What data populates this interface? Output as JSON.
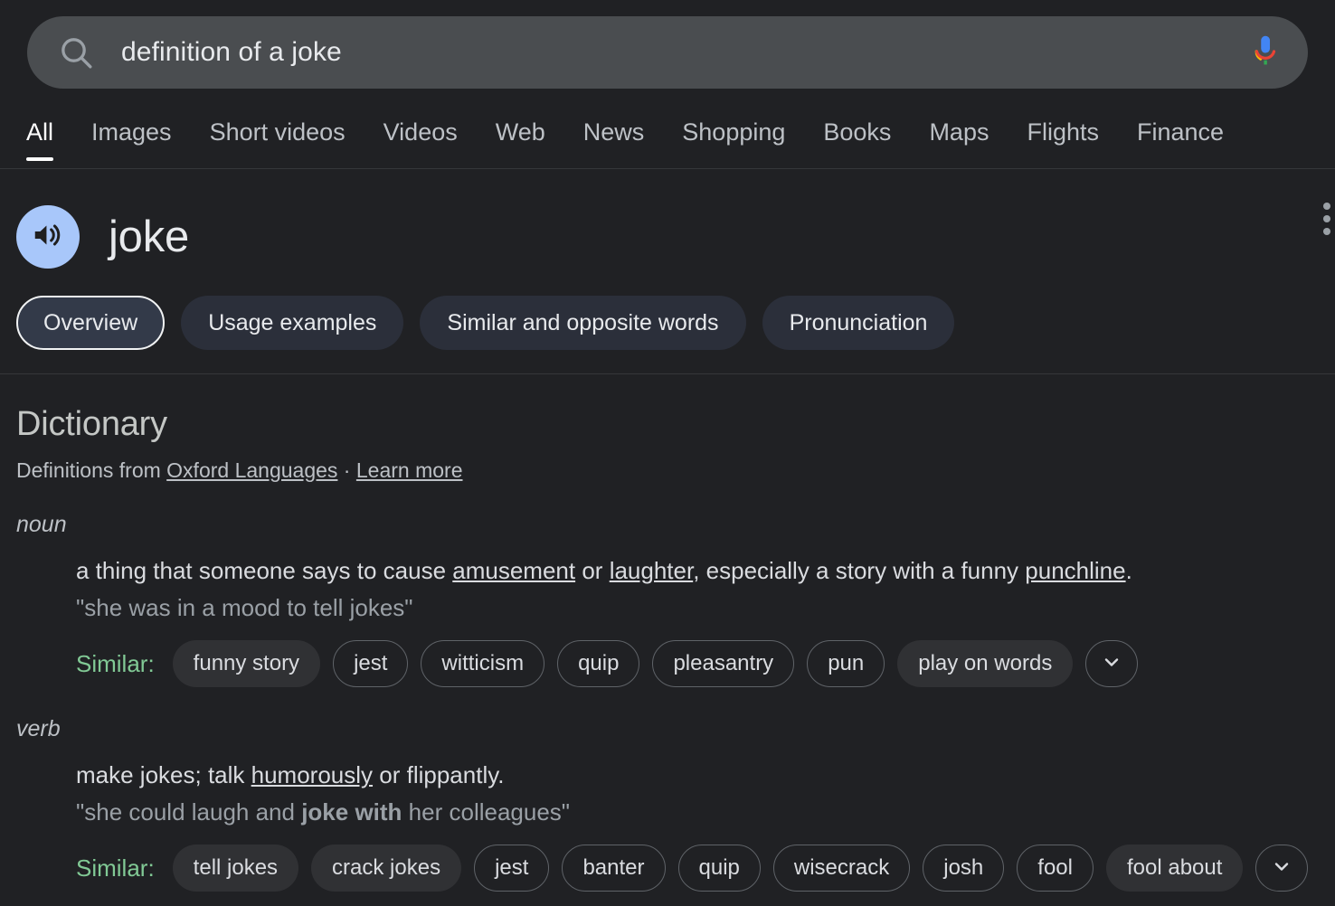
{
  "search": {
    "query": "definition of a joke",
    "placeholder": "Search",
    "search_icon": "search-icon",
    "mic_icon": "microphone-icon"
  },
  "tabs": [
    {
      "label": "All",
      "active": true
    },
    {
      "label": "Images",
      "active": false
    },
    {
      "label": "Short videos",
      "active": false
    },
    {
      "label": "Videos",
      "active": false
    },
    {
      "label": "Web",
      "active": false
    },
    {
      "label": "News",
      "active": false
    },
    {
      "label": "Shopping",
      "active": false
    },
    {
      "label": "Books",
      "active": false
    },
    {
      "label": "Maps",
      "active": false
    },
    {
      "label": "Flights",
      "active": false
    },
    {
      "label": "Finance",
      "active": false
    }
  ],
  "word": {
    "headword": "joke",
    "speaker_icon": "volume-up-icon",
    "menu_icon": "more-vertical-icon"
  },
  "section_chips": [
    {
      "label": "Overview",
      "selected": true
    },
    {
      "label": "Usage examples",
      "selected": false
    },
    {
      "label": "Similar and opposite words",
      "selected": false
    },
    {
      "label": "Pronunciation",
      "selected": false
    }
  ],
  "dictionary": {
    "title": "Dictionary",
    "source_prefix": "Definitions from ",
    "source_link": "Oxford Languages",
    "source_separator": " · ",
    "learn_more": "Learn more",
    "similar_label": "Similar:",
    "expand_icon": "chevron-down-icon",
    "entries": [
      {
        "part_of_speech": "noun",
        "definition_parts": [
          {
            "text": "a thing that someone says to cause ",
            "link": false
          },
          {
            "text": "amusement",
            "link": true
          },
          {
            "text": " or ",
            "link": false
          },
          {
            "text": "laughter",
            "link": true
          },
          {
            "text": ", especially a story with a funny ",
            "link": false
          },
          {
            "text": "punchline",
            "link": true
          },
          {
            "text": ".",
            "link": false
          }
        ],
        "example_parts": [
          {
            "text": "\"she was in a mood to tell jokes\"",
            "bold": false
          }
        ],
        "synonyms": [
          {
            "label": "funny story",
            "style": "filled"
          },
          {
            "label": "jest",
            "style": "outline"
          },
          {
            "label": "witticism",
            "style": "outline"
          },
          {
            "label": "quip",
            "style": "outline"
          },
          {
            "label": "pleasantry",
            "style": "outline"
          },
          {
            "label": "pun",
            "style": "outline"
          },
          {
            "label": "play on words",
            "style": "filled"
          }
        ]
      },
      {
        "part_of_speech": "verb",
        "definition_parts": [
          {
            "text": "make jokes; talk ",
            "link": false
          },
          {
            "text": "humorously",
            "link": true
          },
          {
            "text": " or flippantly.",
            "link": false
          }
        ],
        "example_parts": [
          {
            "text": "\"she could laugh and ",
            "bold": false
          },
          {
            "text": "joke with",
            "bold": true
          },
          {
            "text": " her colleagues\"",
            "bold": false
          }
        ],
        "synonyms": [
          {
            "label": "tell jokes",
            "style": "filled"
          },
          {
            "label": "crack jokes",
            "style": "filled"
          },
          {
            "label": "jest",
            "style": "outline"
          },
          {
            "label": "banter",
            "style": "outline"
          },
          {
            "label": "quip",
            "style": "outline"
          },
          {
            "label": "wisecrack",
            "style": "outline"
          },
          {
            "label": "josh",
            "style": "outline"
          },
          {
            "label": "fool",
            "style": "outline"
          },
          {
            "label": "fool about",
            "style": "filled"
          }
        ]
      }
    ]
  },
  "colors": {
    "page_background": "#202124",
    "searchbar_background": "#4a4d50",
    "section_chip": "#2b2f3a",
    "section_chip_selected_border": "#f1f3f4",
    "speaker_button": "#a8c7fa",
    "similar_label": "#81c995",
    "filled_synonym": "#303134",
    "outline_synonym_border": "#5f6368",
    "primary_text": "#e8eaed",
    "secondary_text": "#bdc1c6",
    "muted_text": "#9aa0a6",
    "divider": "#35373a"
  }
}
